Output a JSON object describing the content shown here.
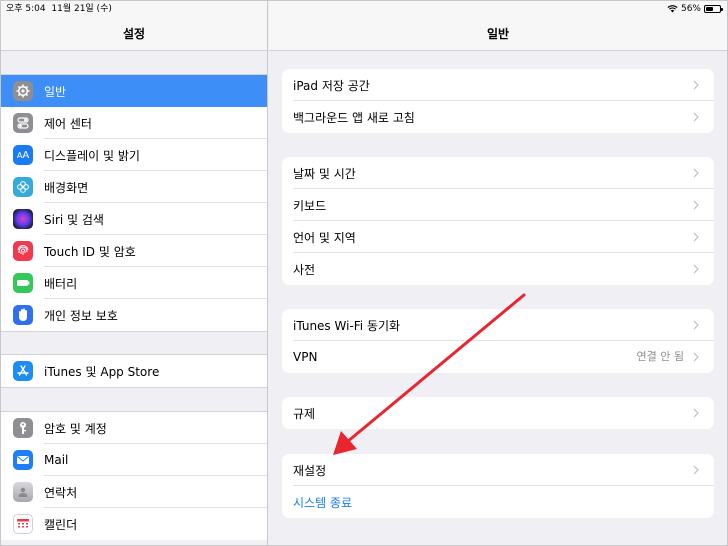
{
  "status": {
    "time": "오후 5:04",
    "date": "11월 21일 (수)",
    "battery": "56%",
    "battery_level": 0.56
  },
  "sidebar": {
    "title": "설정",
    "groups": [
      [
        {
          "label": "일반",
          "icon": "gear-icon",
          "color": "#8e8e93",
          "selected": true
        },
        {
          "label": "제어 센터",
          "icon": "toggle-icon",
          "color": "#8e8e93"
        },
        {
          "label": "디스플레이 및 밝기",
          "icon": "text-size-icon",
          "color": "#1a7cf5"
        },
        {
          "label": "배경화면",
          "icon": "flower-icon",
          "color": "#35aadc"
        },
        {
          "label": "Siri 및 검색",
          "icon": "siri-icon",
          "color": "#222233"
        },
        {
          "label": "Touch ID 및 암호",
          "icon": "fingerprint-icon",
          "color": "#f0384f"
        },
        {
          "label": "배터리",
          "icon": "battery-icon",
          "color": "#34c759"
        },
        {
          "label": "개인 정보 보호",
          "icon": "hand-icon",
          "color": "#2f6ff0"
        }
      ],
      [
        {
          "label": "iTunes 및 App Store",
          "icon": "app-store-icon",
          "color": "#1d8cf5"
        }
      ],
      [
        {
          "label": "암호 및 계정",
          "icon": "key-icon",
          "color": "#8e8e93"
        },
        {
          "label": "Mail",
          "icon": "mail-icon",
          "color": "#1f7ef5"
        },
        {
          "label": "연락처",
          "icon": "contacts-icon",
          "color": "#b7b7bc"
        },
        {
          "label": "캘린더",
          "icon": "calendar-icon",
          "color": "#ffffff"
        }
      ]
    ]
  },
  "main": {
    "title": "일반",
    "groups": [
      [
        {
          "label": "iPad 저장 공간",
          "chevron": true
        },
        {
          "label": "백그라운드 앱 새로 고침",
          "chevron": true
        }
      ],
      [
        {
          "label": "날짜 및 시간",
          "chevron": true
        },
        {
          "label": "키보드",
          "chevron": true
        },
        {
          "label": "언어 및 지역",
          "chevron": true
        },
        {
          "label": "사전",
          "chevron": true
        }
      ],
      [
        {
          "label": "iTunes Wi-Fi 동기화",
          "chevron": true
        },
        {
          "label": "VPN",
          "value": "연결 안 됨",
          "chevron": true
        }
      ],
      [
        {
          "label": "규제",
          "chevron": true
        }
      ],
      [
        {
          "label": "재설정",
          "chevron": true
        },
        {
          "label": "시스템 종료",
          "link": true
        }
      ]
    ]
  },
  "colors": {
    "accent": "#1a7cf5",
    "selected_bg": "#3d8ff7",
    "arrow": "#e8262f"
  }
}
